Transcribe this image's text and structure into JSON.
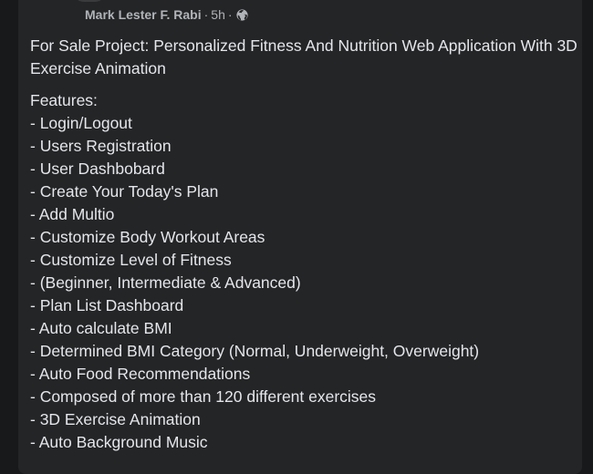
{
  "post": {
    "author": "Mark Lester F. Rabi",
    "separator": "·",
    "time": "5h",
    "title": "For Sale Project: Personalized Fitness And Nutrition Web Application With 3D Exercise Animation",
    "features_heading": "Features:",
    "features": [
      "- Login/Logout",
      "- Users Registration",
      "- User Dashbobard",
      "- Create Your Today's Plan",
      "- Add Multio",
      "- Customize Body Workout Areas",
      "- Customize Level of Fitness",
      "- (Beginner, Intermediate & Advanced)",
      "- Plan List Dashboard",
      "- Auto calculate BMI",
      "- Determined BMI Category (Normal, Underweight, Overweight)",
      "- Auto Food Recommendations",
      "- Composed of more than 120 different exercises",
      "- 3D Exercise Animation",
      "- Auto Background Music"
    ]
  },
  "icons": {
    "privacy": "globe-icon"
  },
  "colors": {
    "page_background": "#18191a",
    "card_background": "#242526",
    "primary_text": "#e4e6eb",
    "secondary_text": "#b0b3b8"
  }
}
